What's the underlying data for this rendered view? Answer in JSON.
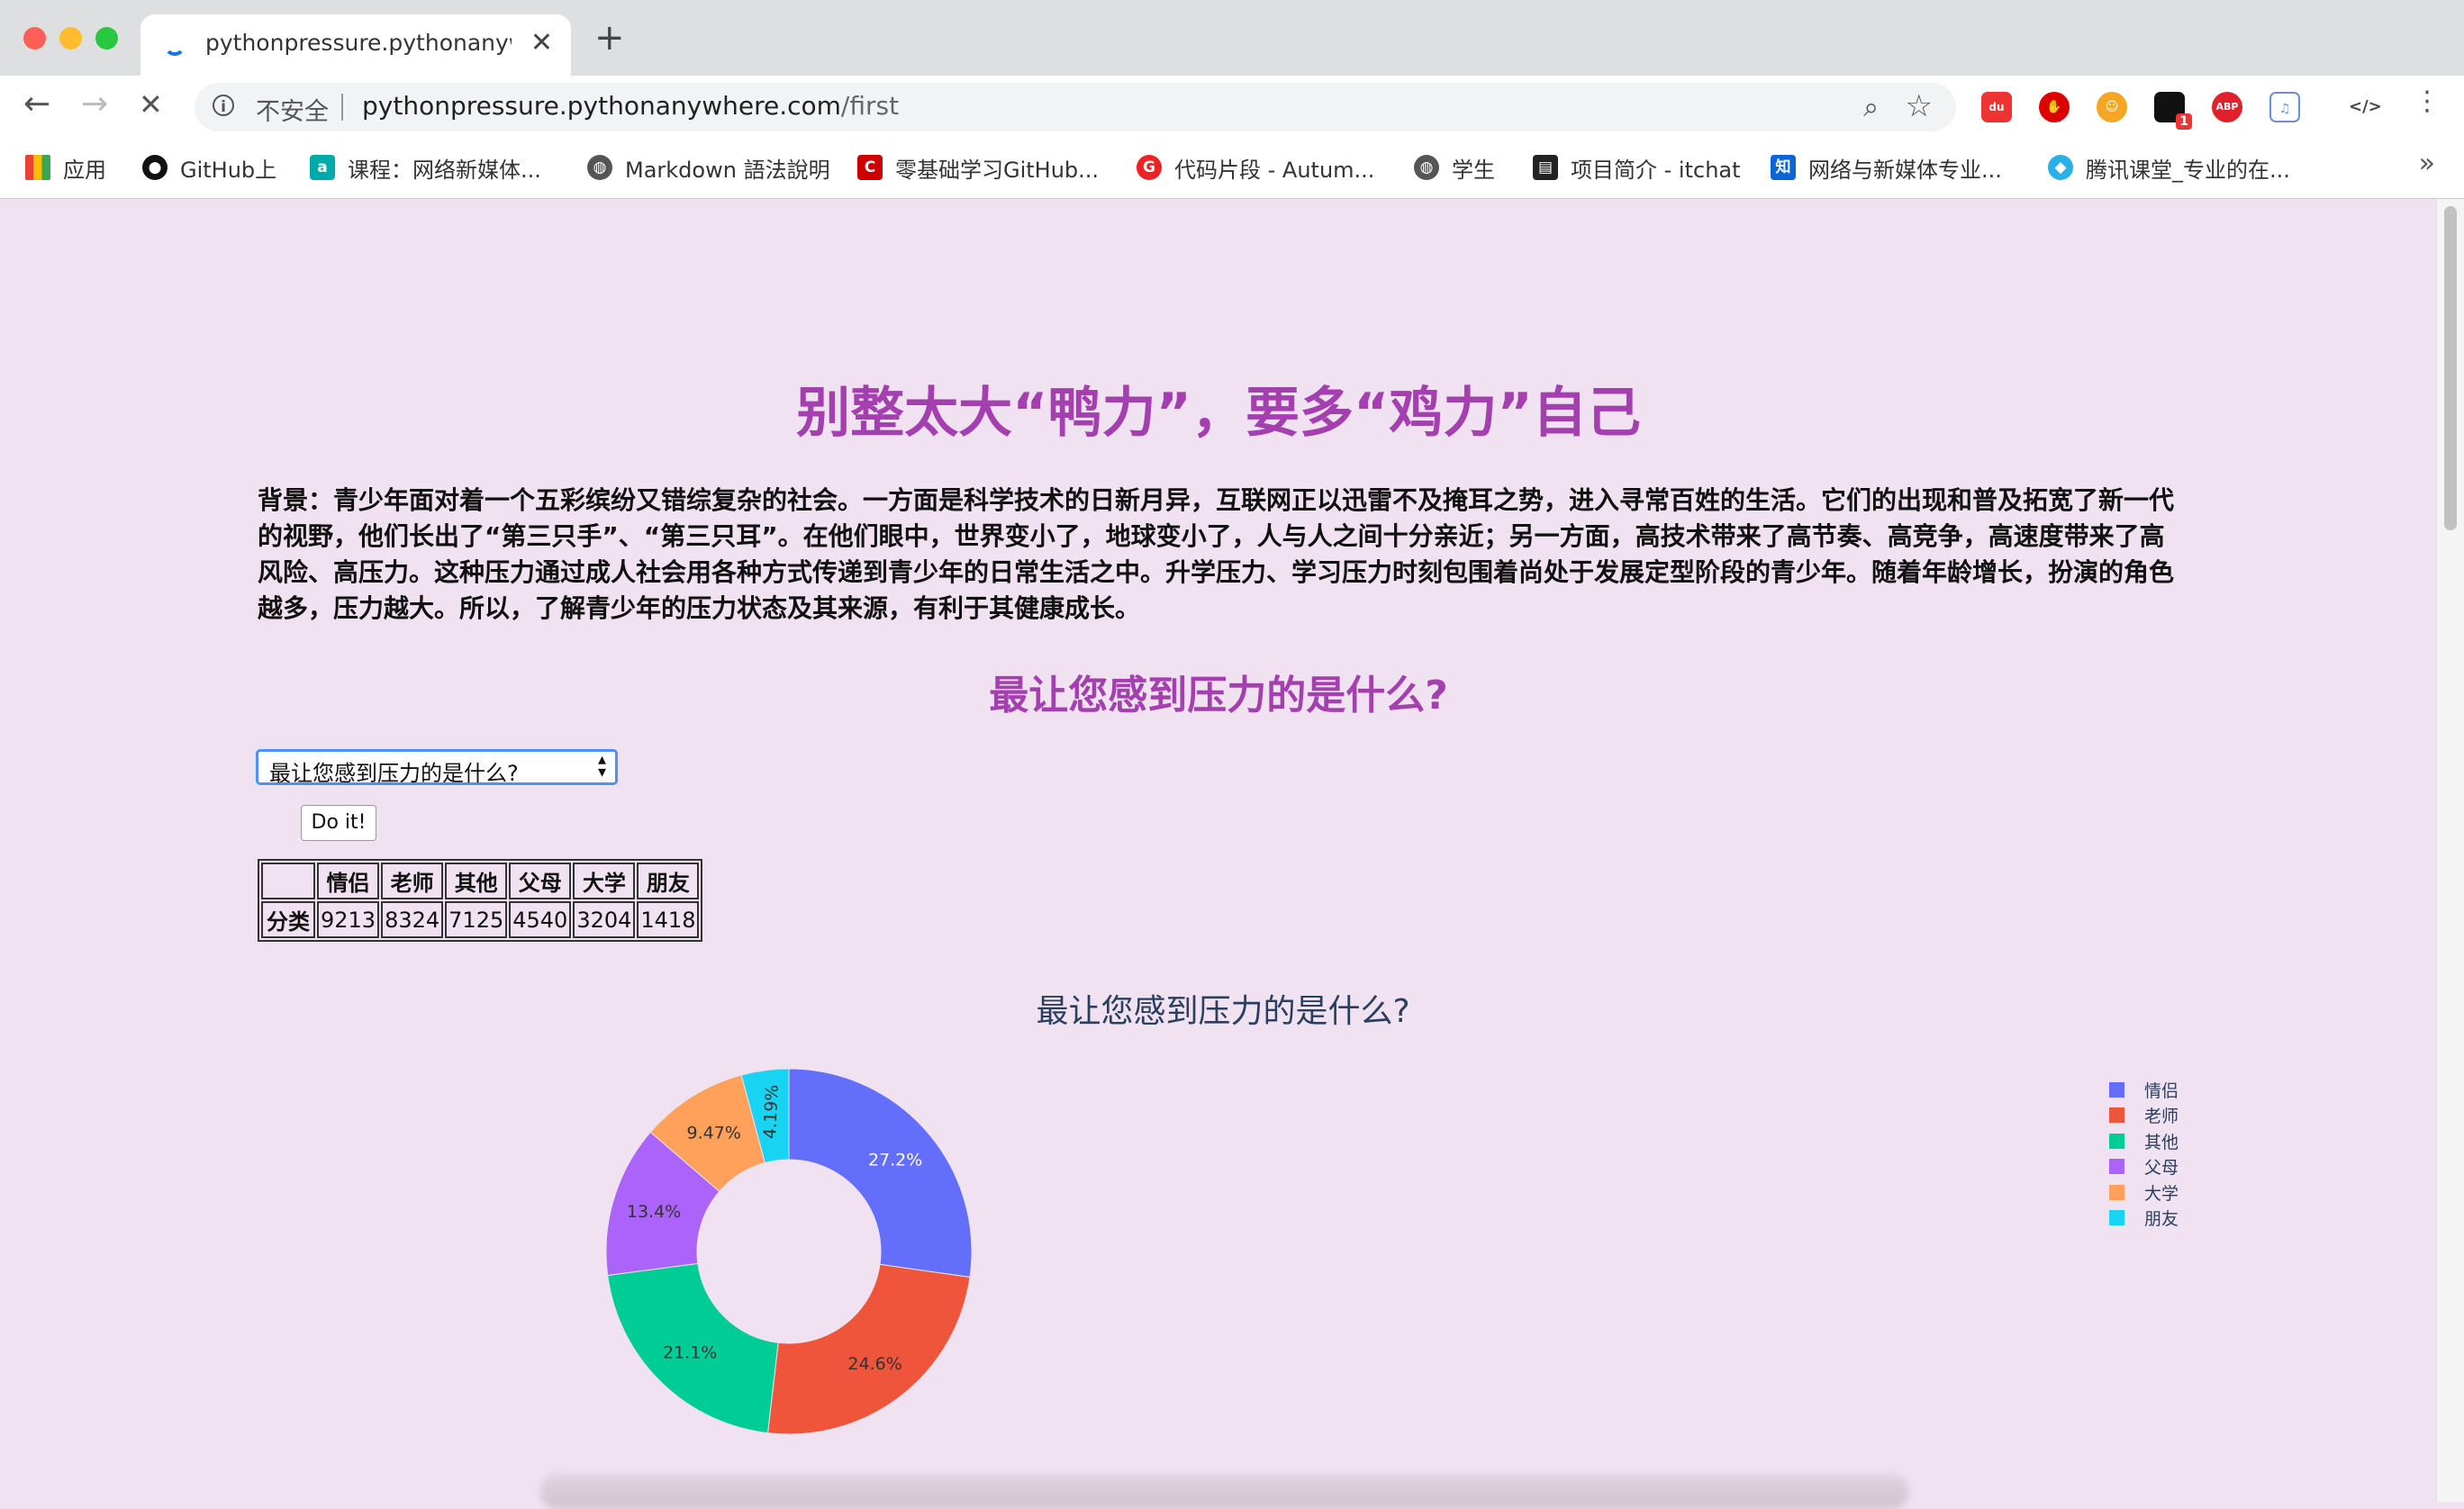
{
  "browser": {
    "tab_title": "pythonpressure.pythonanywhere.com/first",
    "security_label": "不安全",
    "url_host": "pythonpressure.pythonanywhere.com",
    "url_path": "/first",
    "bookmarks": [
      {
        "label": "应用",
        "icon": "apps-grid-icon"
      },
      {
        "label": "GitHub上",
        "icon": "github-icon"
      },
      {
        "label": "课程：网络新媒体...",
        "icon": "course-icon"
      },
      {
        "label": "Markdown 語法說明",
        "icon": "globe-icon"
      },
      {
        "label": "零基础学习GitHub...",
        "icon": "csdn-icon"
      },
      {
        "label": "代码片段 - Autum...",
        "icon": "g-icon"
      },
      {
        "label": "学生",
        "icon": "globe-icon"
      },
      {
        "label": "项目简介 - itchat",
        "icon": "book-icon"
      },
      {
        "label": "网络与新媒体专业...",
        "icon": "zhihu-icon"
      },
      {
        "label": "腾讯课堂_专业的在...",
        "icon": "tencent-icon"
      }
    ],
    "extension_badge": "1"
  },
  "page": {
    "title": "别整太大“鸭力”，要多“鸡力”自己",
    "background": "背景：青少年面对着一个五彩缤纷又错综复杂的社会。一方面是科学技术的日新月异，互联网正以迅雷不及掩耳之势，进入寻常百姓的生活。它们的出现和普及拓宽了新一代的视野，他们长出了“第三只手”、“第三只耳”。在他们眼中，世界变小了，地球变小了，人与人之间十分亲近；另一方面，高技术带来了高节奏、高竞争，高速度带来了高风险、高压力。这种压力通过成人社会用各种方式传递到青少年的日常生活之中。升学压力、学习压力时刻包围着尚处于发展定型阶段的青少年。随着年龄增长，扮演的角色越多，压力越大。所以，了解青少年的压力状态及其来源，有利于其健康成长。",
    "question": "最让您感到压力的是什么?",
    "select_value": "最让您感到压力的是什么?",
    "button_label": "Do it!",
    "table": {
      "headers": [
        "",
        "情侣",
        "老师",
        "其他",
        "父母",
        "大学",
        "朋友"
      ],
      "row_label": "分类",
      "values": [
        "9213",
        "8324",
        "7125",
        "4540",
        "3204",
        "1418"
      ]
    }
  },
  "chart_data": {
    "type": "pie",
    "hole": true,
    "title": "最让您感到压力的是什么?",
    "labels": [
      "情侣",
      "老师",
      "其他",
      "父母",
      "大学",
      "朋友"
    ],
    "values": [
      9213,
      8324,
      7125,
      4540,
      3204,
      1418
    ],
    "percent_labels": [
      "27.2%",
      "24.6%",
      "21.1%",
      "13.4%",
      "9.47%",
      "4.19%"
    ],
    "colors": [
      "#636efa",
      "#ef553b",
      "#00cc96",
      "#ab63fa",
      "#ffa15a",
      "#19d3f3"
    ],
    "legend_position": "top-right"
  }
}
